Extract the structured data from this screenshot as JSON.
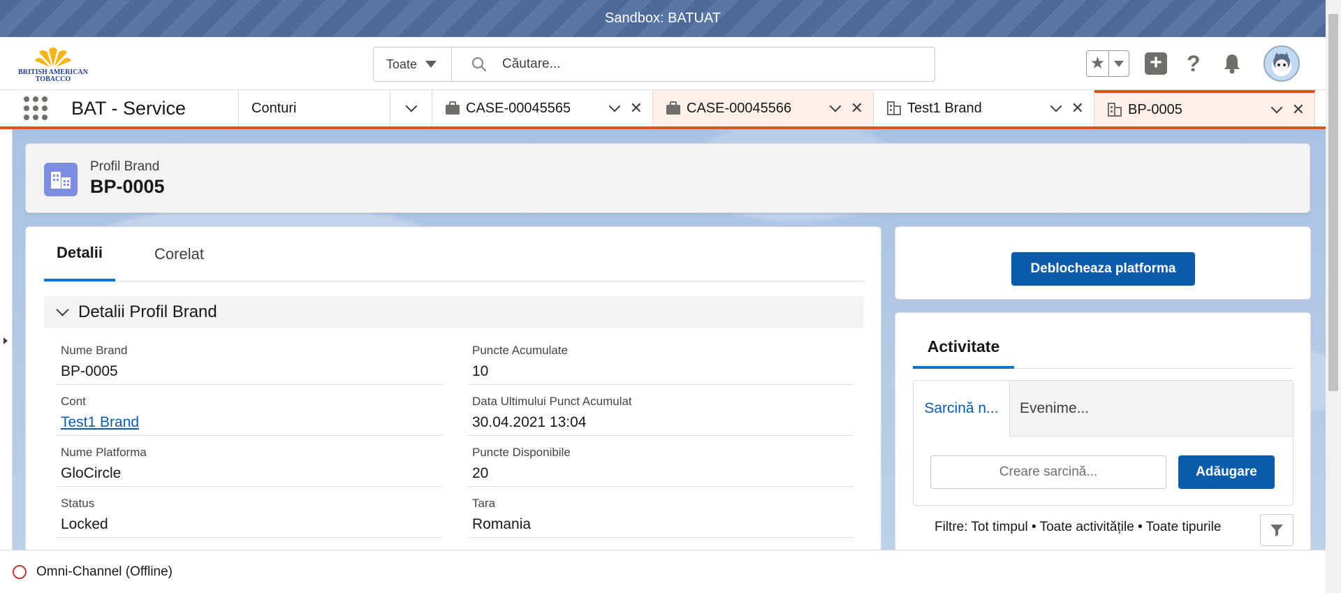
{
  "banner": {
    "text": "Sandbox: BATUAT"
  },
  "header": {
    "logo_text_line1": "BRITISH AMERICAN",
    "logo_text_line2": "TOBACCO",
    "search_scope": "Toate",
    "search_placeholder": "Căutare..."
  },
  "nav": {
    "app_name": "BAT - Service",
    "object_nav": "Conturi",
    "tabs": [
      {
        "label": "CASE-00045565",
        "icon": "briefcase-icon"
      },
      {
        "label": "CASE-00045566",
        "icon": "briefcase-icon"
      },
      {
        "label": "Test1 Brand",
        "icon": "building-icon"
      },
      {
        "label": "BP-0005",
        "icon": "building-icon"
      }
    ]
  },
  "record": {
    "type": "Profil Brand",
    "title": "BP-0005"
  },
  "detail_tabs": [
    "Detalii",
    "Corelat"
  ],
  "section_title": "Detalii Profil Brand",
  "fields": {
    "left": [
      {
        "label": "Nume Brand",
        "value": "BP-0005"
      },
      {
        "label": "Cont",
        "value": "Test1 Brand"
      },
      {
        "label": "Nume Platforma",
        "value": "GloCircle"
      },
      {
        "label": "Status",
        "value": "Locked"
      }
    ],
    "right": [
      {
        "label": "Puncte Acumulate",
        "value": "10"
      },
      {
        "label": "Data Ultimului Punct Acumulat",
        "value": "30.04.2021 13:04"
      },
      {
        "label": "Puncte Disponibile",
        "value": "20"
      },
      {
        "label": "Tara",
        "value": "Romania"
      }
    ]
  },
  "actions": {
    "unlock_label": "Deblocheaza platforma"
  },
  "activity": {
    "tab_label": "Activitate",
    "composer_tabs": [
      "Sarcină n...",
      "Evenime..."
    ],
    "task_placeholder": "Creare sarcină...",
    "add_label": "Adăugare",
    "filters_text": "Filtre: Tot timpul • Toate activitățile • Toate tipurile"
  },
  "footer": {
    "omni_label": "Omni-Channel (Offline)"
  },
  "colors": {
    "brand_blue": "#0b5cab",
    "tab_accent": "#e2521a",
    "record_icon": "#7f8de1",
    "offline_red": "#c23934"
  }
}
